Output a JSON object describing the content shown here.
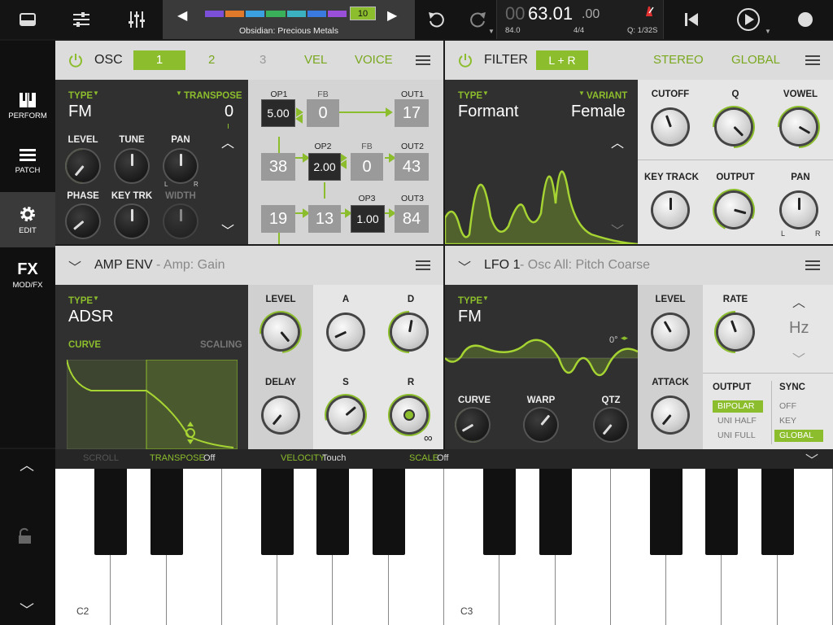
{
  "top": {
    "preset_number": "10",
    "preset_name": "Obsidian: Precious Metals",
    "time": "63.01",
    "time_prefix": "00",
    "time_suffix": ".00",
    "bpm": "84.0",
    "signature": "4/4",
    "quantize": "Q: 1/32S",
    "preset_colors": [
      "#7b4fd8",
      "#e07a2a",
      "#3aa0e0",
      "#3ab05a",
      "#3ab0c0",
      "#3a7ae0",
      "#9a4fd8"
    ]
  },
  "sidebar": [
    {
      "label": "PERFORM",
      "icon": "piano-icon"
    },
    {
      "label": "PATCH",
      "icon": "list-icon"
    },
    {
      "label": "EDIT",
      "icon": "gear-icon"
    },
    {
      "label": "MOD/FX",
      "icon": "fx-icon",
      "glyph": "FX"
    }
  ],
  "osc": {
    "title": "OSC",
    "tabs": [
      "1",
      "2",
      "3"
    ],
    "vel": "VEL",
    "voice": "VOICE",
    "type_label": "TYPE",
    "type": "FM",
    "transpose_label": "TRANSPOSE",
    "transpose": "0",
    "level": "LEVEL",
    "tune": "TUNE",
    "pan": "PAN",
    "pan_l": "L",
    "pan_r": "R",
    "phase": "PHASE",
    "key_trk": "KEY TRK",
    "width": "WIDTH",
    "fm": {
      "op1": "OP1",
      "fb1": "FB",
      "out1": "OUT1",
      "op1_val": "5.00",
      "fb1_val": "0",
      "out1_val": "17",
      "op2": "OP2",
      "fb2": "FB",
      "out2": "OUT2",
      "v38": "38",
      "op2_val": "2.00",
      "fb2_val": "0",
      "out2_val": "43",
      "op3": "OP3",
      "out3": "OUT3",
      "v19": "19",
      "v13": "13",
      "op3_val": "1.00",
      "out3_val": "84"
    }
  },
  "filter": {
    "title": "FILTER",
    "mode": "L + R",
    "stereo": "STEREO",
    "global": "GLOBAL",
    "type_label": "TYPE",
    "type": "Formant",
    "variant_label": "VARIANT",
    "variant": "Female",
    "cutoff": "CUTOFF",
    "q": "Q",
    "vowel": "VOWEL",
    "key_track": "KEY TRACK",
    "output": "OUTPUT",
    "pan": "PAN",
    "pan_l": "L",
    "pan_r": "R"
  },
  "amp": {
    "title": "AMP ENV",
    "subtitle": "- Amp: Gain",
    "type_label": "TYPE",
    "type": "ADSR",
    "curve": "CURVE",
    "scaling": "SCALING",
    "level": "LEVEL",
    "delay": "DELAY",
    "a": "A",
    "d": "D",
    "s": "S",
    "r": "R",
    "inf": "∞"
  },
  "lfo": {
    "title": "LFO 1",
    "subtitle": "- Osc All: Pitch Coarse",
    "type_label": "TYPE",
    "type": "FM",
    "phase": "0°",
    "curve": "CURVE",
    "warp": "WARP",
    "qtz": "QTZ",
    "level": "LEVEL",
    "attack": "ATTACK",
    "rate": "RATE",
    "unit": "Hz",
    "output": "OUTPUT",
    "sync": "SYNC",
    "outputs": [
      "BIPOLAR",
      "UNI HALF",
      "UNI FULL"
    ],
    "syncs": [
      "OFF",
      "KEY",
      "GLOBAL"
    ]
  },
  "kbd": {
    "scroll": "SCROLL",
    "transpose_label": "TRANSPOSE",
    "transpose": "Off",
    "velocity_label": "VELOCITY",
    "velocity": "Touch",
    "scale_label": "SCALE",
    "scale": "Off",
    "c2": "C2",
    "c3": "C3"
  }
}
